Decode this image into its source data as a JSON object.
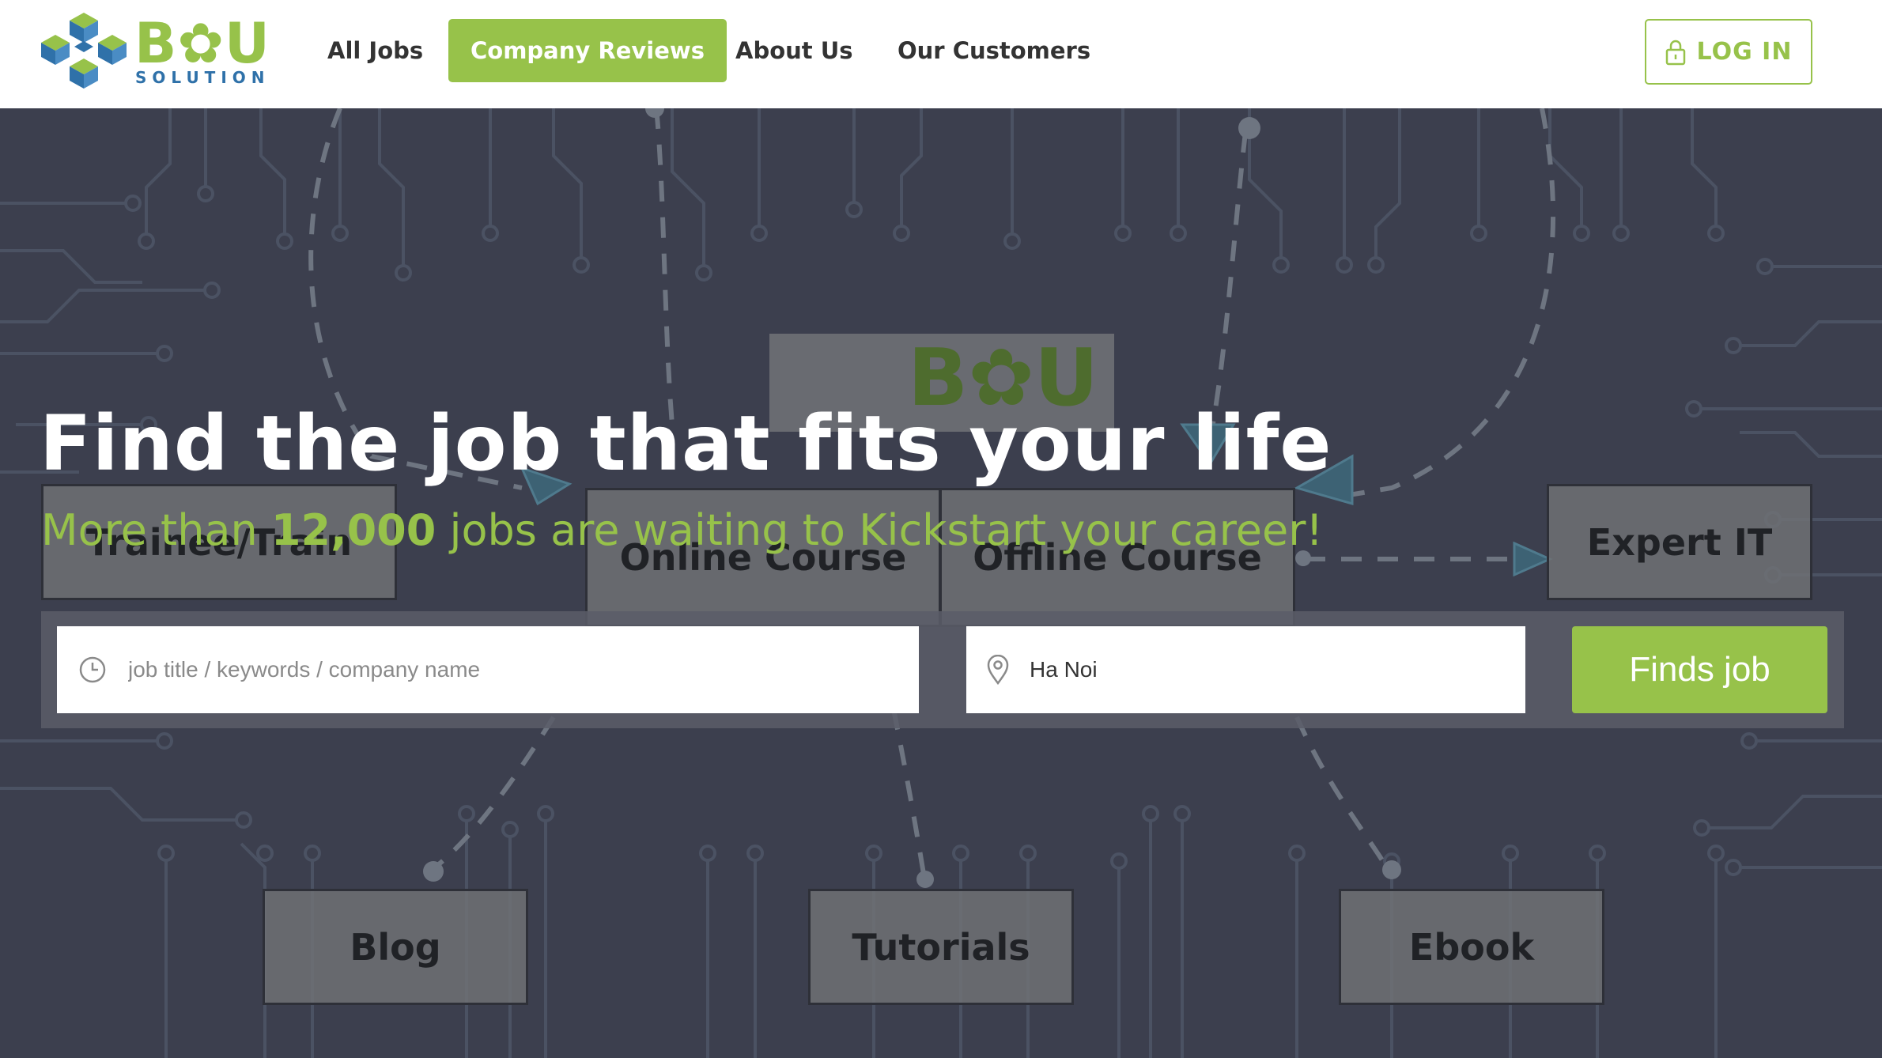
{
  "brand": {
    "logo_text": "B✿U",
    "logo_sub": "SOLUTION",
    "primary_color": "#97c24a",
    "secondary_color": "#2f71a9"
  },
  "nav": {
    "items": [
      {
        "label": "All Jobs",
        "active": false
      },
      {
        "label": "Company Reviews",
        "active": true
      },
      {
        "label": "About Us",
        "active": false
      },
      {
        "label": "Our Customers",
        "active": false
      }
    ],
    "login_label": "LOG IN",
    "login_icon": "lock-icon"
  },
  "hero": {
    "headline": "Find the job that fits your life",
    "sub_prefix": "More than ",
    "sub_count": "12,000",
    "sub_suffix": " jobs are waiting to Kickstart your career!",
    "background_boxes": [
      "Trainee/Train",
      "Online Course",
      "Offline Course",
      "Expert IT",
      "Blog",
      "Tutorials",
      "Ebook"
    ]
  },
  "search": {
    "keywords_placeholder": "job title / keywords / company name",
    "keywords_value": "",
    "keywords_icon": "clock-icon",
    "location_value": "Ha Noi",
    "location_icon": "location-pin-icon",
    "submit_label": "Finds job"
  }
}
